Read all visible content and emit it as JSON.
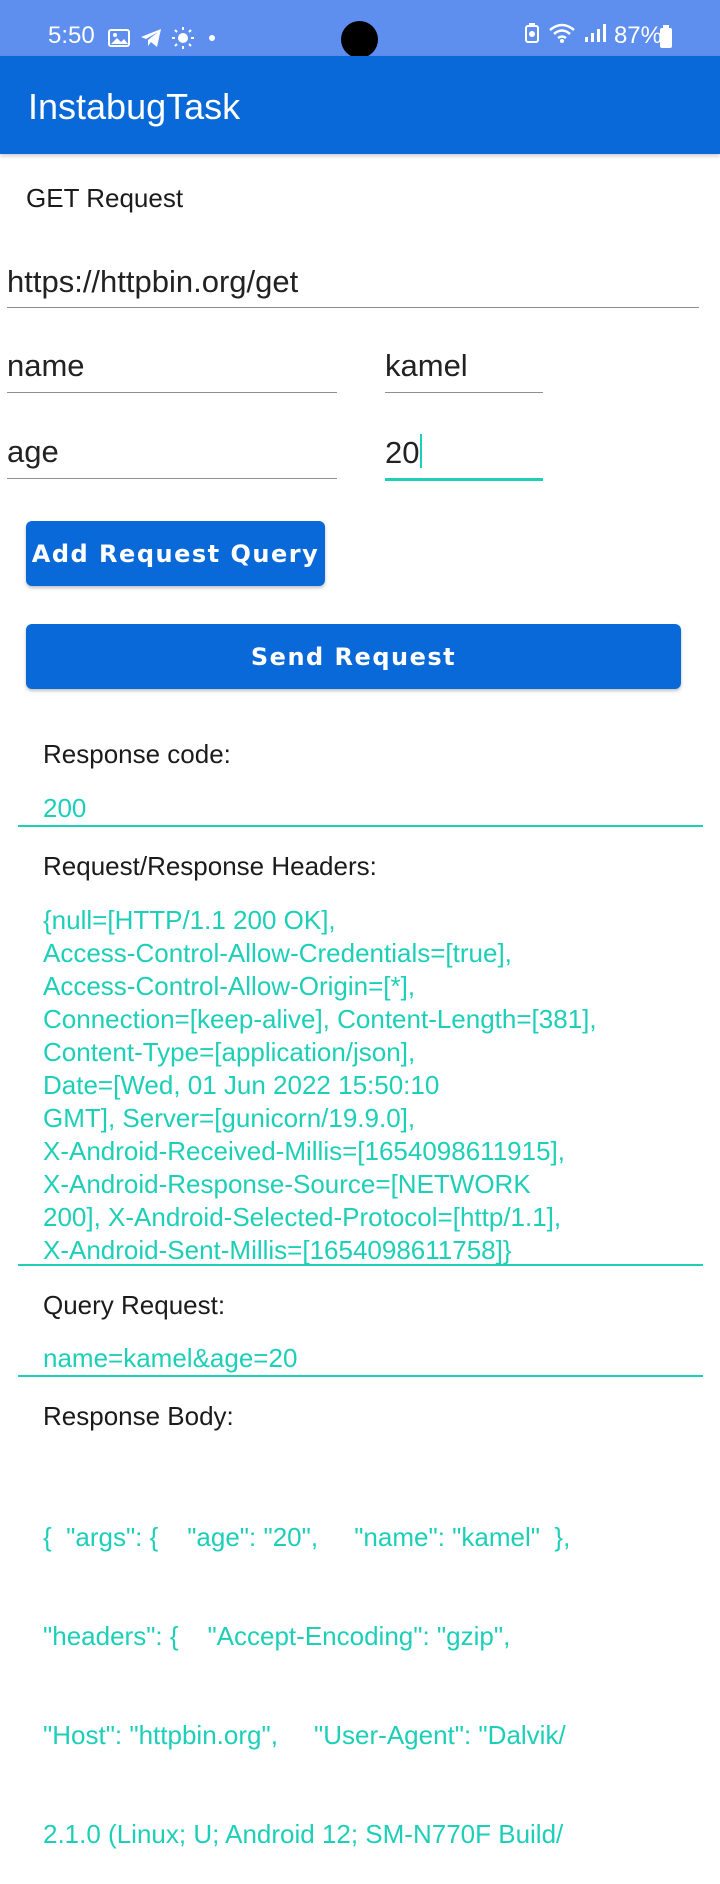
{
  "status_bar": {
    "time": "5:50",
    "battery": "87%",
    "icons_left": [
      "gallery-icon",
      "telegram-icon",
      "brightness-icon",
      "dot-icon"
    ],
    "icons_right": [
      "battery-saver-icon",
      "wifi-icon",
      "signal-icon"
    ]
  },
  "app_bar": {
    "title": "InstabugTask"
  },
  "form": {
    "section_label": "GET Request",
    "url_value": "https://httpbin.org/get",
    "query_rows": [
      {
        "key": "name",
        "value": "kamel"
      },
      {
        "key": "age",
        "value": "20"
      }
    ],
    "add_query_button": "Add Request Query",
    "send_button": "Send Request"
  },
  "response": {
    "code_label": "Response code:",
    "code_value": "200",
    "headers_label": "Request/Response Headers:",
    "headers_lines": [
      "{null=[HTTP/1.1 200 OK],",
      "Access-Control-Allow-Credentials=[true],",
      "Access-Control-Allow-Origin=[*],",
      "Connection=[keep-alive], Content-Length=[381],",
      "Content-Type=[application/json],",
      "Date=[Wed, 01 Jun 2022 15:50:10",
      "GMT], Server=[gunicorn/19.9.0],",
      "X-Android-Received-Millis=[1654098611915],",
      "X-Android-Response-Source=[NETWORK",
      "200], X-Android-Selected-Protocol=[http/1.1],",
      "X-Android-Sent-Millis=[1654098611758]}"
    ],
    "query_label": "Query Request:",
    "query_value": "name=kamel&age=20",
    "body_label": "Response Body:",
    "body_lines": [
      "{  \"args\": {    \"age\": \"20\",     \"name\": \"kamel\"  },",
      "\"headers\": {    \"Accept-Encoding\": \"gzip\",",
      "\"Host\": \"httpbin.org\",     \"User-Agent\": \"Dalvik/",
      "2.1.0 (Linux; U; Android 12; SM-N770F Build/"
    ]
  }
}
